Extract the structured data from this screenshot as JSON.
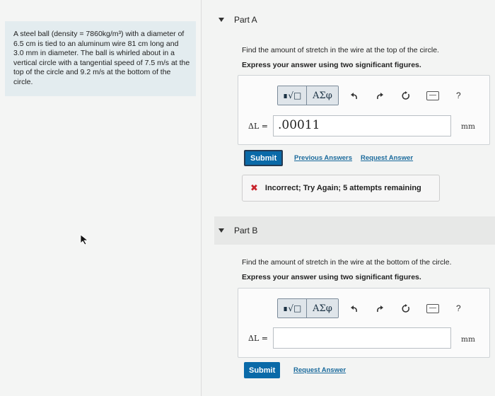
{
  "problem": {
    "text": "A steel ball (density = 7860kg/m³) with a diameter of 6.5 cm is tied to an aluminum wire 81 cm long and 3.0 mm in diameter. The ball is whirled about in a vertical circle with a tangential speed of 7.5 m/s at the top of the circle and 9.2 m/s at the bottom of the circle."
  },
  "toolbar": {
    "radical_label": "∎√□",
    "greek_label": "ΑΣφ",
    "undo_icon": "undo-icon",
    "redo_icon": "redo-icon",
    "reset_icon": "reset-icon",
    "keyboard_icon": "keyboard-icon",
    "help_label": "?"
  },
  "part_a": {
    "title": "Part A",
    "question": "Find the amount of stretch in the wire at the top of the circle.",
    "instruction": "Express your answer using two significant figures.",
    "eq_label": "ΔL =",
    "answer_value": ".00011",
    "unit": "mm",
    "submit_label": "Submit",
    "previous_answers_label": "Previous Answers",
    "request_answer_label": "Request Answer",
    "feedback": "Incorrect; Try Again; 5 attempts remaining"
  },
  "part_b": {
    "title": "Part B",
    "question": "Find the amount of stretch in the wire at the bottom of the circle.",
    "instruction": "Express your answer using two significant figures.",
    "eq_label": "ΔL =",
    "answer_value": "",
    "unit": "mm",
    "submit_label": "Submit",
    "request_answer_label": "Request Answer"
  },
  "colors": {
    "submit_bg": "#0a6aa8",
    "problem_bg": "#e3ecef",
    "error_icon": "#c8232c",
    "link": "#1a6a9c"
  }
}
